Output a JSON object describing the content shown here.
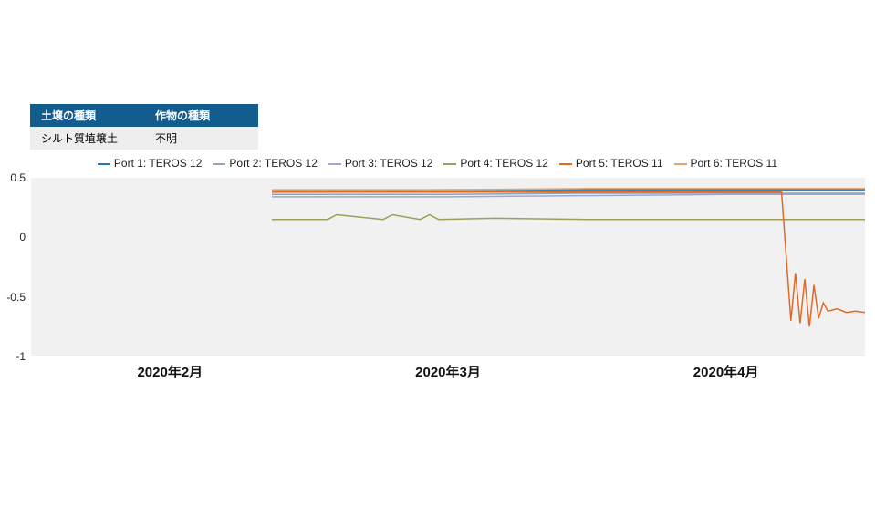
{
  "table": {
    "headers": [
      "土壌の種類",
      "作物の種類"
    ],
    "row": [
      "シルト質埴壌土",
      "不明"
    ]
  },
  "legend": [
    {
      "label": "Port 1: TEROS 12",
      "color": "#1f77b4"
    },
    {
      "label": "Port 2: TEROS 12",
      "color": "#8ea3b8"
    },
    {
      "label": "Port 3: TEROS 12",
      "color": "#9aa8d4"
    },
    {
      "label": "Port 4: TEROS 12",
      "color": "#9e9e5b"
    },
    {
      "label": "Port 5: TEROS 11",
      "color": "#e06a26"
    },
    {
      "label": "Port 6: TEROS 11",
      "color": "#eaa46a"
    }
  ],
  "chart_data": {
    "type": "line",
    "title": "",
    "xlabel": "",
    "ylabel": "",
    "ylim": [
      -1,
      0.5
    ],
    "y_ticks": [
      0.5,
      0,
      -0.5,
      -1
    ],
    "x_ticks": [
      "2020年2月",
      "2020年3月",
      "2020年4月"
    ],
    "x_range_days": [
      0,
      90
    ],
    "x_tick_days": [
      15,
      45,
      75
    ],
    "data_start_day": 26,
    "series": [
      {
        "name": "Port 1: TEROS 12",
        "color": "#1f77b4",
        "x": [
          26,
          45,
          60,
          75,
          90
        ],
        "y": [
          0.39,
          0.4,
          0.4,
          0.4,
          0.4
        ]
      },
      {
        "name": "Port 2: TEROS 12",
        "color": "#8ea3b8",
        "x": [
          26,
          45,
          60,
          75,
          90
        ],
        "y": [
          0.36,
          0.36,
          0.37,
          0.37,
          0.37
        ]
      },
      {
        "name": "Port 3: TEROS 12",
        "color": "#9aa8d4",
        "x": [
          26,
          45,
          60,
          75,
          90
        ],
        "y": [
          0.34,
          0.34,
          0.35,
          0.36,
          0.36
        ]
      },
      {
        "name": "Port 4: TEROS 12",
        "color": "#9e9e5b",
        "x": [
          26,
          32,
          33,
          38,
          39,
          42,
          43,
          44,
          50,
          60,
          75,
          90
        ],
        "y": [
          0.15,
          0.15,
          0.19,
          0.15,
          0.19,
          0.15,
          0.19,
          0.15,
          0.16,
          0.15,
          0.15,
          0.15
        ]
      },
      {
        "name": "Port 5: TEROS 11",
        "color": "#e06a26",
        "x": [
          26,
          45,
          60,
          75,
          81,
          82,
          82.5,
          83,
          83.5,
          84,
          84.5,
          85,
          85.5,
          86,
          87,
          88,
          89,
          90
        ],
        "y": [
          0.38,
          0.38,
          0.38,
          0.38,
          0.38,
          -0.7,
          -0.3,
          -0.72,
          -0.35,
          -0.75,
          -0.4,
          -0.68,
          -0.55,
          -0.62,
          -0.6,
          -0.63,
          -0.62,
          -0.63
        ]
      },
      {
        "name": "Port 6: TEROS 11",
        "color": "#eaa46a",
        "x": [
          26,
          45,
          60,
          75,
          90
        ],
        "y": [
          0.4,
          0.4,
          0.41,
          0.41,
          0.41
        ]
      }
    ]
  }
}
